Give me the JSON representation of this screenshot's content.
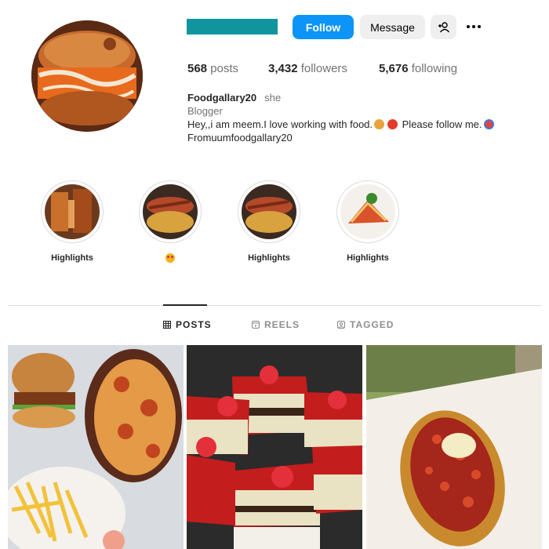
{
  "profile": {
    "username": "",
    "stats": {
      "posts_count": "568",
      "posts_label": "posts",
      "followers_count": "3,432",
      "followers_label": "followers",
      "following_count": "5,676",
      "following_label": "following"
    },
    "bio": {
      "name": "Foodgallary20",
      "pronoun": "she",
      "category": "Blogger",
      "line1_a": "Hey,,i am meem.I love working with food.",
      "line1_b": "Please follow me.",
      "line2": "Fromuumfoodgallary20"
    }
  },
  "actions": {
    "follow_label": "Follow",
    "message_label": "Message",
    "add_user_icon": "add-person-icon",
    "more_icon": "more-dots-icon"
  },
  "highlights": [
    {
      "label": "Highlights"
    },
    {
      "label": ""
    },
    {
      "label": "Highlights"
    },
    {
      "label": "Highlights"
    }
  ],
  "tabs": {
    "posts": "POSTS",
    "reels": "REELS",
    "tagged": "TAGGED",
    "active": "posts"
  },
  "colors": {
    "follow_button": "#0c95f6",
    "username_redacted_bar": "#10959f",
    "secondary_button": "#efefef"
  }
}
